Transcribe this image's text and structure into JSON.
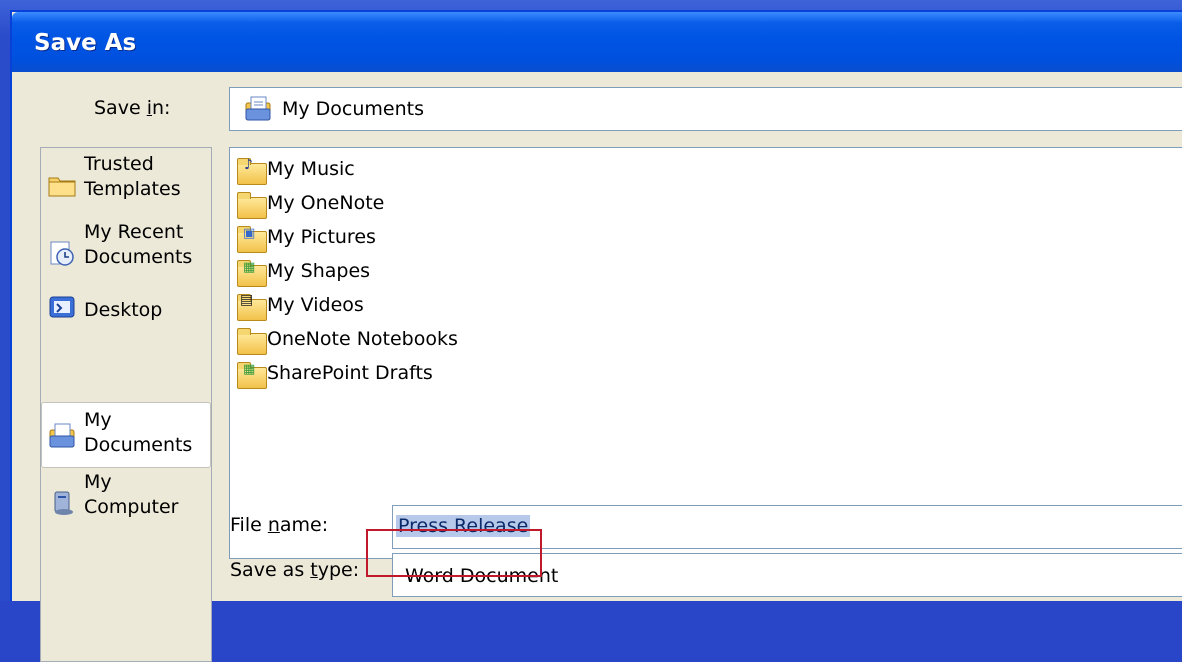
{
  "dialog": {
    "title": "Save As"
  },
  "save_in": {
    "label_pre": "Save ",
    "label_hot": "i",
    "label_post": "n:",
    "value": "My Documents",
    "icon": "my-documents-icon"
  },
  "places": [
    {
      "label_line1": "Trusted",
      "label_line2": "Templates",
      "icon": "folder-icon",
      "selected": false
    },
    {
      "label_line1": "My Recent",
      "label_line2": "Documents",
      "icon": "recent-documents-icon",
      "selected": false
    },
    {
      "label_line1": "Desktop",
      "label_line2": "",
      "icon": "desktop-icon",
      "selected": false
    },
    {
      "label_line1": "My",
      "label_line2": "Documents",
      "icon": "my-documents-icon",
      "selected": true
    },
    {
      "label_line1": "My",
      "label_line2": "Computer",
      "icon": "computer-icon",
      "selected": false
    }
  ],
  "files": [
    {
      "name": "My Music",
      "icon": "music-folder-icon"
    },
    {
      "name": "My OneNote",
      "icon": "folder-icon"
    },
    {
      "name": "My Pictures",
      "icon": "pictures-folder-icon"
    },
    {
      "name": "My Shapes",
      "icon": "shapes-folder-icon"
    },
    {
      "name": "My Videos",
      "icon": "videos-folder-icon"
    },
    {
      "name": "OneNote Notebooks",
      "icon": "folder-icon"
    },
    {
      "name": "SharePoint Drafts",
      "icon": "sharepoint-folder-icon"
    }
  ],
  "file_name": {
    "label_pre": "File ",
    "label_hot": "n",
    "label_post": "ame:",
    "value": "Press Release"
  },
  "save_type": {
    "label_pre": "Save as ",
    "label_hot": "t",
    "label_post": "ype:",
    "value": "Word Document"
  },
  "colors": {
    "title_bar": "#0054e3",
    "highlight": "#c0192b",
    "dialog_bg": "#ece9d8"
  }
}
